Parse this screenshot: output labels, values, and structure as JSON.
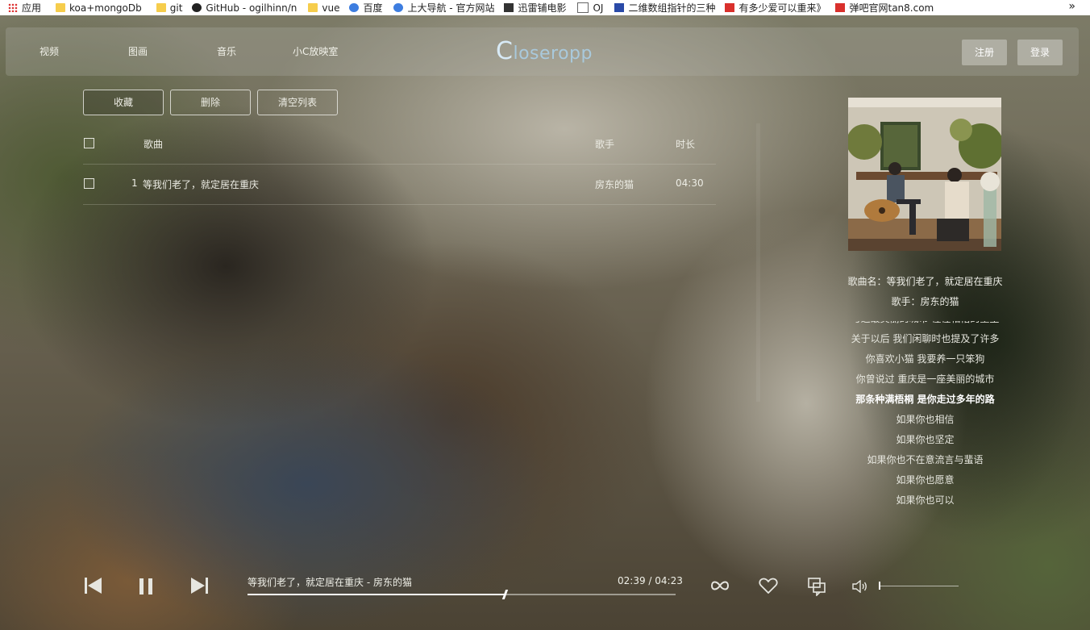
{
  "bookmarks": {
    "items": [
      {
        "label": "应用",
        "icon": "apps-grid-icon"
      },
      {
        "label": "koa+mongoDb",
        "icon": "folder-icon"
      },
      {
        "label": "git",
        "icon": "folder-icon"
      },
      {
        "label": "GitHub - ogilhinn/n",
        "icon": "github-icon"
      },
      {
        "label": "vue",
        "icon": "folder-icon"
      },
      {
        "label": "百度",
        "icon": "baidu-paw-icon"
      },
      {
        "label": "上大导航 - 官方网站",
        "icon": "globe-icon"
      },
      {
        "label": "迅雷铺电影",
        "icon": "site-icon"
      },
      {
        "label": "OJ",
        "icon": "page-icon"
      },
      {
        "label": "二维数组指针的三种",
        "icon": "image-icon"
      },
      {
        "label": "有多少爱可以重来》",
        "icon": "red-square-icon"
      },
      {
        "label": "弹吧官网tan8.com",
        "icon": "tan8-icon"
      }
    ],
    "more": "»"
  },
  "nav": {
    "items": [
      "视频",
      "图画",
      "音乐",
      "小C放映室"
    ],
    "logo_initial": "C",
    "logo_rest": "loseropp",
    "register": "注册",
    "login": "登录"
  },
  "actions": {
    "collect": "收藏",
    "delete": "删除",
    "clear": "清空列表"
  },
  "playlist": {
    "headers": {
      "song": "歌曲",
      "singer": "歌手",
      "duration": "时长"
    },
    "rows": [
      {
        "index": "1",
        "title": "等我们老了，就定居在重庆",
        "singer": "房东的猫",
        "duration": "04:30"
      }
    ]
  },
  "now_playing": {
    "song_name_line": "歌曲名：等我们老了，就定居在重庆",
    "singer_line": "歌手：房东的猫",
    "cover_icon": "album-cover-image",
    "lyrics": [
      "与之最美丽的城市 惺惺相惜的重生",
      "关于以后 我们闲聊时也提及了许多",
      "你喜欢小猫 我要养一只笨狗",
      "你曾说过 重庆是一座美丽的城市",
      "那条种满梧桐 是你走过多年的路",
      "如果你也相信",
      "如果你也坚定",
      "如果你也不在意流言与蜚语",
      "如果你也愿意",
      "如果你也可以"
    ],
    "active_lyric_index": 4
  },
  "player": {
    "track_line": "等我们老了，就定居在重庆 - 房东的猫",
    "time_line": "02:39 / 04:23",
    "progress_fraction": 0.6,
    "volume_fraction": 0.0,
    "icons": {
      "prev": "skip-previous-icon",
      "pause": "pause-icon",
      "next": "skip-next-icon",
      "loop": "loop-infinity-icon",
      "like": "heart-icon",
      "lyrics": "chat-bubbles-icon",
      "volume": "volume-icon"
    }
  },
  "colors": {
    "logo": "#a9c9dc",
    "text": "#e8e8e0"
  }
}
